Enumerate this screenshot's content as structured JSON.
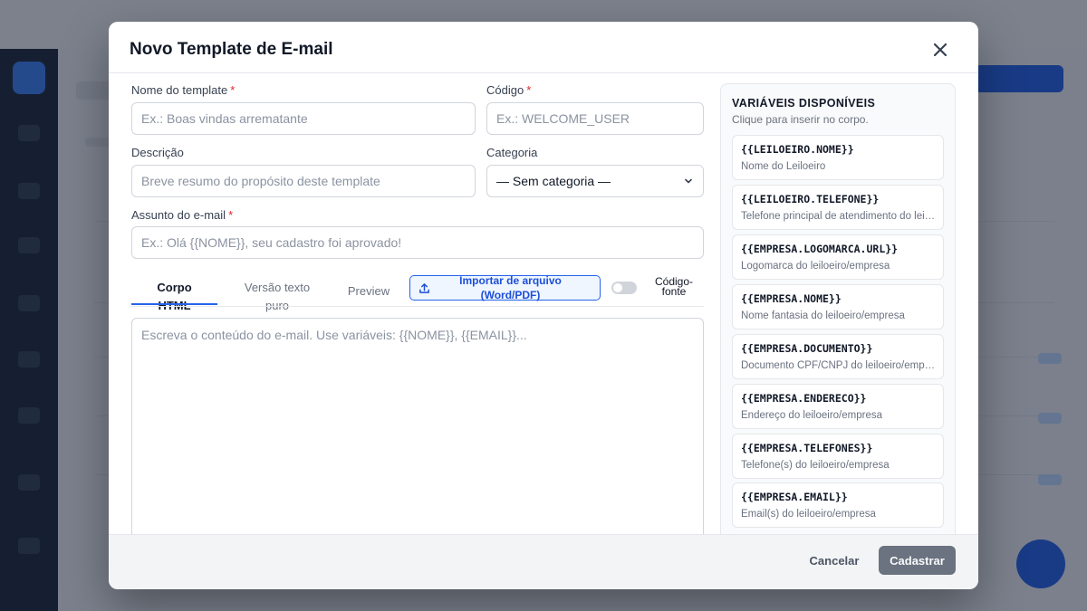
{
  "modal": {
    "title": "Novo Template de E-mail",
    "close_icon": "close-icon"
  },
  "form": {
    "name": {
      "label": "Nome do template",
      "required_mark": "*",
      "placeholder": "Ex.: Boas vindas arrematante",
      "value": ""
    },
    "code": {
      "label": "Código",
      "required_mark": "*",
      "placeholder": "Ex.: WELCOME_USER",
      "value": ""
    },
    "description": {
      "label": "Descrição",
      "placeholder": "Breve resumo do propósito deste template",
      "value": ""
    },
    "category": {
      "label": "Categoria",
      "selected": "— Sem categoria —",
      "icon": "chevron-down-icon"
    },
    "subject": {
      "label": "Assunto do e-mail",
      "required_mark": "*",
      "placeholder": "Ex.: Olá {{NOME}}, seu cadastro foi aprovado!",
      "value": ""
    }
  },
  "tabs": {
    "html": {
      "line1": "Corpo",
      "line2": "HTML"
    },
    "text": {
      "line1": "Versão texto",
      "line2": "puro"
    },
    "preview": {
      "label": "Preview"
    }
  },
  "import_button": {
    "line1": "Importar de arquivo",
    "line2": "(Word/PDF)",
    "icon": "upload-icon"
  },
  "source_toggle": {
    "line1": "Código-",
    "line2": "fonte",
    "on": false
  },
  "editor": {
    "placeholder": "Escreva o conteúdo do e-mail. Use variáveis: {{NOME}}, {{EMAIL}}...",
    "value": ""
  },
  "variables": {
    "title": "VARIÁVEIS DISPONÍVEIS",
    "subtitle": "Clique para inserir no corpo.",
    "items": [
      {
        "code": "{{LEILOEIRO.NOME}}",
        "desc": "Nome do Leiloeiro"
      },
      {
        "code": "{{LEILOEIRO.TELEFONE}}",
        "desc": "Telefone principal de atendimento do leiloeiro"
      },
      {
        "code": "{{EMPRESA.LOGOMARCA.URL}}",
        "desc": "Logomarca do leiloeiro/empresa"
      },
      {
        "code": "{{EMPRESA.NOME}}",
        "desc": "Nome fantasia do leiloeiro/empresa"
      },
      {
        "code": "{{EMPRESA.DOCUMENTO}}",
        "desc": "Documento CPF/CNPJ do leiloeiro/empresa"
      },
      {
        "code": "{{EMPRESA.ENDERECO}}",
        "desc": "Endereço do leiloeiro/empresa"
      },
      {
        "code": "{{EMPRESA.TELEFONES}}",
        "desc": "Telefone(s) do leiloeiro/empresa"
      },
      {
        "code": "{{EMPRESA.EMAIL}}",
        "desc": "Email(s) do leiloeiro/empresa"
      }
    ]
  },
  "footer": {
    "cancel_label": "Cancelar",
    "submit_label": "Cadastrar"
  },
  "colors": {
    "accent": "#2563eb",
    "required": "#dc2626",
    "submit_disabled": "#6b7280"
  }
}
